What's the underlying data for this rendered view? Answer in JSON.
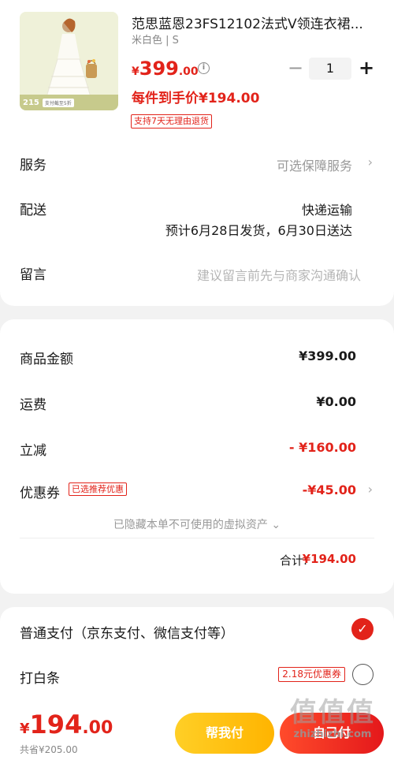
{
  "product": {
    "title": "范思蓝恩23FS12102法式V领连衣裙...",
    "spec": "米白色 | S",
    "price_currency": "¥",
    "price_int": "399",
    "price_dec": ".00",
    "info_symbol": "i",
    "qty_minus": "−",
    "quantity": "1",
    "qty_plus": "+",
    "final_price": "每件到手价¥194.00",
    "return_tag": "支持7天无理由退货",
    "thumb_number": "215",
    "thumb_text": "支付截至5折"
  },
  "rows": {
    "service_label": "服务",
    "service_value": "可选保障服务",
    "delivery_label": "配送",
    "delivery_method": "快递运输",
    "delivery_estimate": "预计6月28日发货，6月30日送达",
    "message_label": "留言",
    "message_placeholder": "建议留言前先与商家沟通确认",
    "chevron": "›"
  },
  "summary": {
    "goods_label": "商品金额",
    "goods_value": "¥399.00",
    "shipping_label": "运费",
    "shipping_value": "¥0.00",
    "discount_label": "立减",
    "discount_value": "- ¥160.00",
    "coupon_label": "优惠券",
    "coupon_tag": "已选推荐优惠",
    "coupon_value": "-¥45.00",
    "hidden_assets": "已隐藏本单不可使用的虚拟资产 ⌄",
    "total_label": "合计:",
    "total_value": "¥194.00"
  },
  "payment": {
    "normal_label": "普通支付（京东支付、微信支付等）",
    "normal_selected": true,
    "baitiao_label": "打白条",
    "baitiao_tag": "2.18元优惠券",
    "baitiao_selected": false,
    "check_symbol": "✓"
  },
  "bottom": {
    "currency": "¥",
    "amount_int": "194",
    "amount_dec": ".00",
    "saved": "共省¥205.00",
    "help_pay": "帮我付",
    "self_pay": "自己付"
  },
  "watermark": {
    "big": "值值值",
    "small": "zhizhizhi.com"
  },
  "colors": {
    "accent": "#e2231a",
    "help_button": "#ffc20e"
  }
}
